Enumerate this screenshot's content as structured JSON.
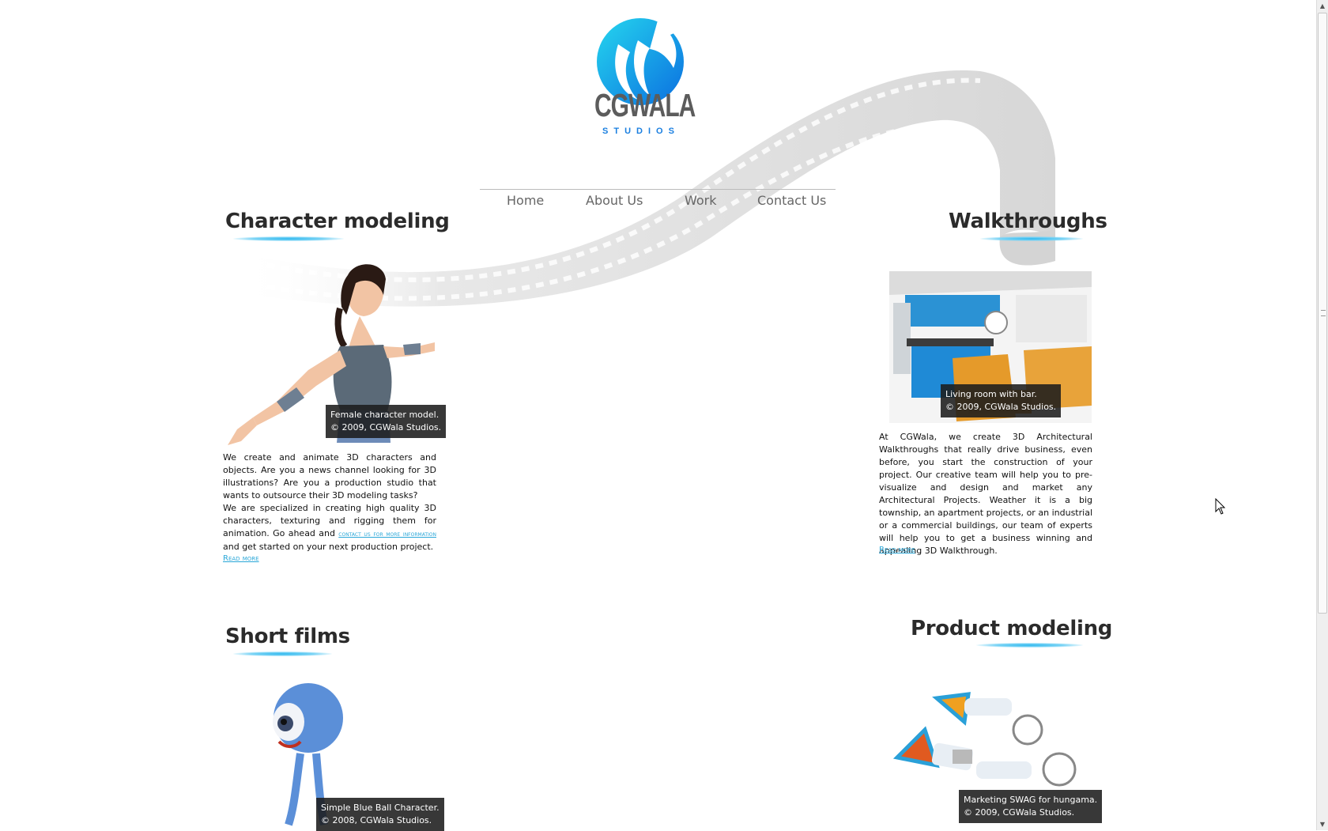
{
  "logo": {
    "title": "CGWALA",
    "subtitle": "STUDIOS"
  },
  "nav": {
    "items": [
      "Home",
      "About Us",
      "Work",
      "Contact Us"
    ]
  },
  "sections": {
    "character": {
      "heading": "Character modeling",
      "caption_line1": "Female character model.",
      "caption_line2": "© 2009, CGWala Studios.",
      "para1": "We create and animate 3D characters and objects. Are you a news channel looking for 3D illustrations? Are you a production studio that wants to outsource their 3D modeling tasks?",
      "para2_before": "We are specialized in creating high quality 3D characters, texturing and rigging them for animation. Go ahead and ",
      "para2_link": "contact us for more information",
      "para2_after": " and get started on your next production project.",
      "read_more": "Read more"
    },
    "walkthroughs": {
      "heading": "Walkthroughs",
      "caption_line1": "Living room with bar.",
      "caption_line2": "© 2009, CGWala Studios.",
      "para": "At CGWala, we create 3D Architectural Walkthroughs that really drive business, even before, you start the construction of your project. Our creative team will help you to pre-visualize and design and market any Architectural Projects. Weather it is a big township, an apartment projects, or an industrial or a commercial buildings, our team of experts will help you to get a business winning and appealing 3D Walkthrough.",
      "read_more": "Read more"
    },
    "short_films": {
      "heading": "Short films",
      "caption_line1": "Simple Blue Ball Character.",
      "caption_line2": "© 2008, CGWala Studios."
    },
    "product": {
      "heading": "Product modeling",
      "caption_line1": "Marketing SWAG for hungama.",
      "caption_line2": "© 2009, CGWala Studios."
    }
  },
  "colors": {
    "accent": "#2aa7d8",
    "logo_blue": "#1ba3e8",
    "heading": "#2b2b2b"
  }
}
